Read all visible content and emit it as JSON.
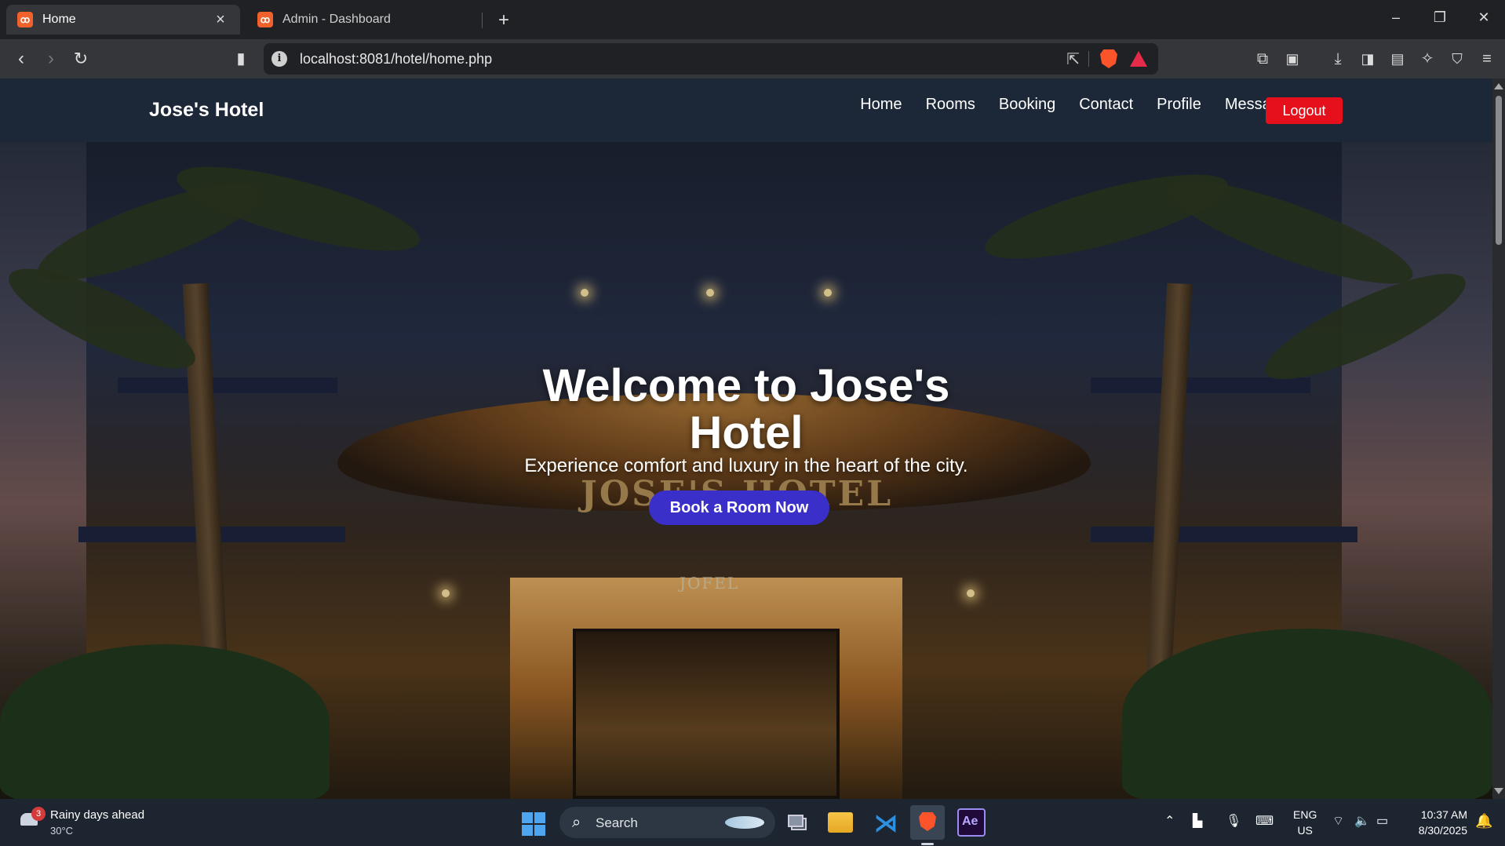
{
  "browser": {
    "tabs": [
      {
        "title": "Home",
        "active": true
      },
      {
        "title": "Admin - Dashboard",
        "active": false
      }
    ],
    "url": "localhost:8081/hotel/home.php"
  },
  "site": {
    "brand": "Jose's Hotel",
    "nav": [
      "Home",
      "Rooms",
      "Booking",
      "Contact",
      "Profile",
      "Messages"
    ],
    "logout_label": "Logout"
  },
  "hero": {
    "title": "Welcome to Jose's Hotel",
    "subtitle": "Experience comfort and luxury in the heart of the city.",
    "cta_label": "Book a Room Now",
    "facade_sign": "JOSE'S HOTEL",
    "door_sign": "JOFEL"
  },
  "taskbar": {
    "weather_text": "Rainy days ahead",
    "weather_temp": "30°C",
    "weather_badge": "3",
    "search_label": "Search",
    "language": "ENG",
    "region": "US",
    "time": "10:37 AM",
    "date": "8/30/2025"
  },
  "colors": {
    "navbar": "#1c2737",
    "logout": "#e5101c",
    "cta": "#3a2fc9"
  }
}
